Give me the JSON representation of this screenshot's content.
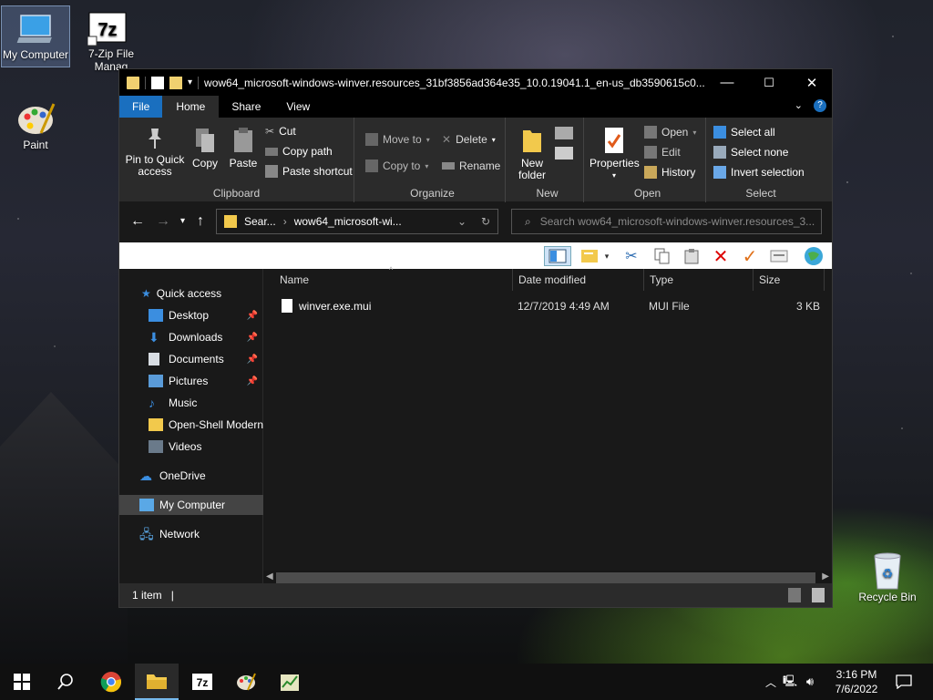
{
  "desktop": {
    "icons": [
      {
        "label": "My Computer"
      },
      {
        "label": "7-Zip File Manag"
      },
      {
        "label": "Paint"
      },
      {
        "label": "Recycle Bin"
      }
    ]
  },
  "window": {
    "title": "wow64_microsoft-windows-winver.resources_31bf3856ad364e35_10.0.19041.1_en-us_db3590615c0...",
    "controls": {
      "minimize": "—",
      "maximize": "☐",
      "close": "✕"
    }
  },
  "ribbon_tabs": [
    "File",
    "Home",
    "Share",
    "View"
  ],
  "ribbon": {
    "clipboard": {
      "label": "Clipboard",
      "pin": "Pin to Quick access",
      "pin_line1": "Pin to Quick",
      "pin_line2": "access",
      "copy": "Copy",
      "paste": "Paste",
      "cut": "Cut",
      "copy_path": "Copy path",
      "paste_shortcut": "Paste shortcut"
    },
    "organize": {
      "label": "Organize",
      "move_to": "Move to",
      "copy_to": "Copy to",
      "delete": "Delete",
      "rename": "Rename"
    },
    "new": {
      "label": "New",
      "new_folder_line1": "New",
      "new_folder_line2": "folder"
    },
    "open": {
      "label": "Open",
      "properties": "Properties",
      "open": "Open",
      "edit": "Edit",
      "history": "History"
    },
    "select": {
      "label": "Select",
      "select_all": "Select all",
      "select_none": "Select none",
      "invert": "Invert selection"
    }
  },
  "address": {
    "crumb1": "Sear...",
    "crumb2": "wow64_microsoft-wi...",
    "search_placeholder": "Search wow64_microsoft-windows-winver.resources_3..."
  },
  "nav": {
    "quick_access": "Quick access",
    "items": [
      {
        "label": "Desktop",
        "pinned": true
      },
      {
        "label": "Downloads",
        "pinned": true
      },
      {
        "label": "Documents",
        "pinned": true
      },
      {
        "label": "Pictures",
        "pinned": true
      },
      {
        "label": "Music",
        "pinned": false
      },
      {
        "label": "Open-Shell Modern",
        "pinned": false
      },
      {
        "label": "Videos",
        "pinned": false
      }
    ],
    "onedrive": "OneDrive",
    "my_computer": "My Computer",
    "network": "Network"
  },
  "columns": {
    "name": "Name",
    "date": "Date modified",
    "type": "Type",
    "size": "Size"
  },
  "files": [
    {
      "name": "winver.exe.mui",
      "date": "12/7/2019 4:49 AM",
      "type": "MUI File",
      "size": "3 KB"
    }
  ],
  "status": {
    "count": "1 item"
  },
  "clock": {
    "time": "3:16 PM",
    "date": "7/6/2022"
  },
  "colors": {
    "accent": "#1a6fbf",
    "window_bg": "#191919",
    "ribbon_bg": "#2b2b2b"
  }
}
